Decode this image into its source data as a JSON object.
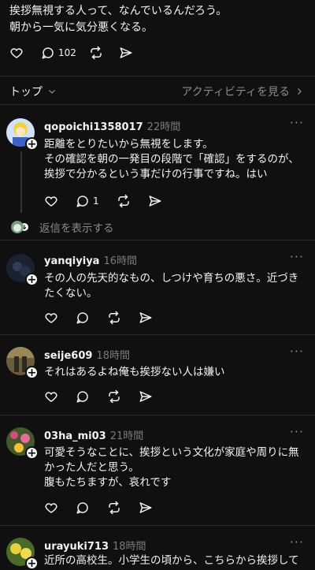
{
  "post": {
    "lines": [
      "挨拶無視する人って、なんでいるんだろう。",
      "朝から一気に気分悪くなる。"
    ],
    "reply_count": "102"
  },
  "sort": {
    "label": "トップ",
    "activity_link": "アクティビティを見る"
  },
  "comments": [
    {
      "username": "qopoichi1358017",
      "time": "22時間",
      "lines": [
        "距離をとりたいから無視をします。",
        "その確認を朝の一発目の段階で「確認」をするのが、",
        "挨拶で分かるという事だけの行事ですね。はい"
      ],
      "reply_count": "1",
      "show_replies": "返信を表示する"
    },
    {
      "username": "yanqiyiya",
      "time": "16時間",
      "lines": [
        "その人の先天的なもの、しつけや育ちの悪さ。近づき",
        "たくない。"
      ]
    },
    {
      "username": "seije609",
      "time": "18時間",
      "lines": [
        "それはあるよね俺も挨拶ない人は嫌い"
      ]
    },
    {
      "username": "03ha_mi03",
      "time": "21時間",
      "lines": [
        "可愛そうなことに、挨拶という文化が家庭や周りに無",
        "かった人だと思う。",
        "腹もたちますが、哀れです"
      ]
    },
    {
      "username": "urayuki713",
      "time": "18時間",
      "lines": [
        "近所の高校生。小学生の頃から、こちらから挨拶して"
      ]
    }
  ],
  "colors": {
    "background": "#101010",
    "text": "#f3f3f3",
    "muted": "#8a8a8a",
    "divider": "#2a2a2a"
  }
}
